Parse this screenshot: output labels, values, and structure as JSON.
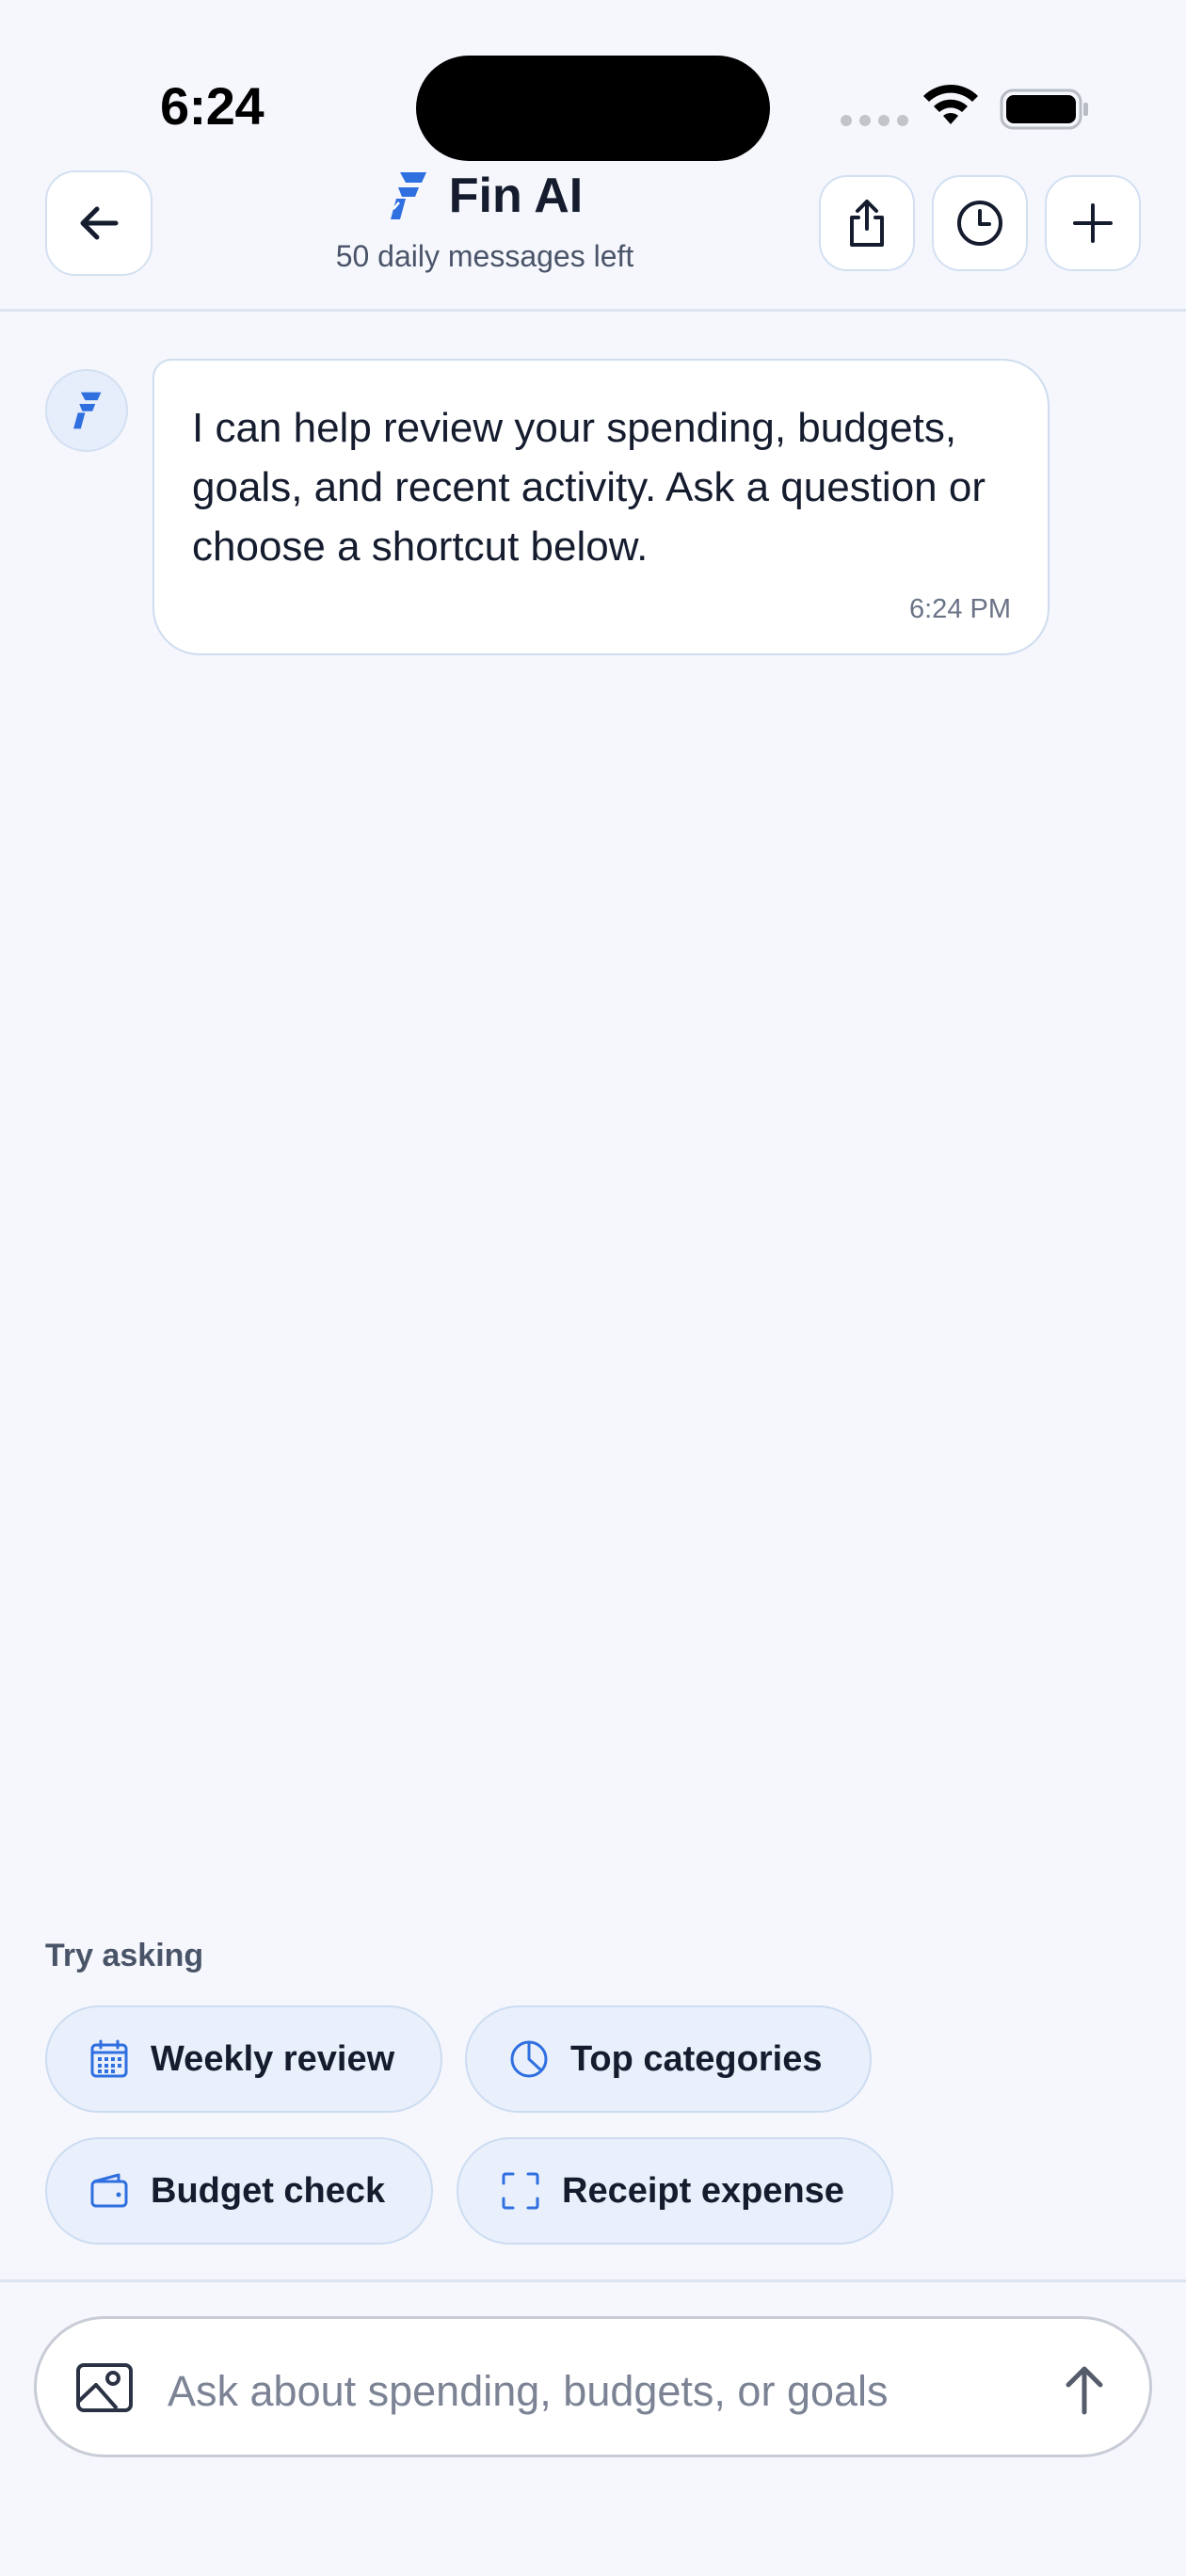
{
  "status_bar": {
    "time": "6:24"
  },
  "header": {
    "title": "Fin AI",
    "subtitle": "50 daily messages left"
  },
  "chat": {
    "messages": [
      {
        "sender": "assistant",
        "text": "I can help review your spending, budgets, goals, and recent activity. Ask a question or choose a shortcut below.",
        "time": "6:24 PM"
      }
    ]
  },
  "suggestions": {
    "label": "Try asking",
    "chips": [
      {
        "label": "Weekly review",
        "icon": "calendar-icon"
      },
      {
        "label": "Top categories",
        "icon": "pie-chart-icon"
      },
      {
        "label": "Budget check",
        "icon": "wallet-icon"
      },
      {
        "label": "Receipt expense",
        "icon": "scan-icon"
      }
    ]
  },
  "composer": {
    "placeholder": "Ask about spending, budgets, or goals",
    "value": ""
  },
  "colors": {
    "accent": "#2f6fe0",
    "background": "#f5f7fc",
    "chip_background": "#e9f0fb"
  }
}
